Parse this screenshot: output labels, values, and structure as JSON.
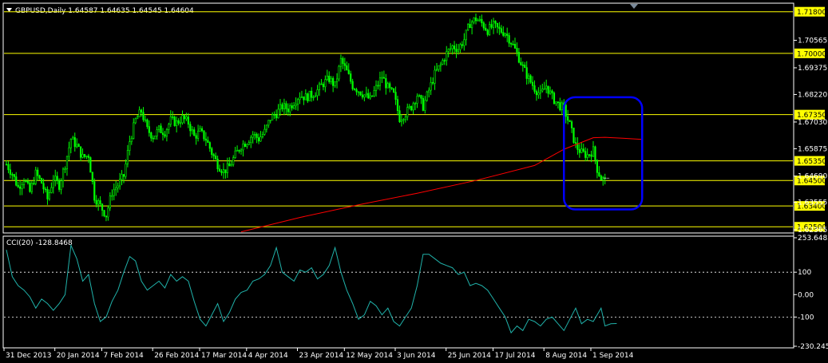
{
  "header": {
    "symbol_title": "GBPUSD,Daily  1.64587 1.64635 1.64545 1.64604"
  },
  "indicator": {
    "title": "CCI(20) -128.8468"
  },
  "colors": {
    "background": "#000000",
    "frame": "#ffffff",
    "candle": "#00ff00",
    "moving_average": "#ff0000",
    "level_line": "#ffff00",
    "level_label_bg": "#ffff00",
    "cci_line": "#20b2aa",
    "highlight_box": "#0000ff",
    "dotted_level": "#ffffff"
  },
  "chart_data": [
    {
      "type": "candlestick",
      "title": "GBPUSD,Daily  1.64587 1.64635 1.64545 1.64604",
      "x_tick_labels": [
        "31 Dec 2013",
        "20 Jan 2014",
        "7 Feb 2014",
        "26 Feb 2014",
        "17 Mar 2014",
        "4 Apr 2014",
        "23 Apr 2014",
        "12 May 2014",
        "3 Jun 2014",
        "25 Jun 2014",
        "17 Jul 2014",
        "8 Aug 2014",
        "1 Sep 2014"
      ],
      "x": [
        "2013-12-31",
        "2014-01-20",
        "2014-02-07",
        "2014-02-26",
        "2014-03-17",
        "2014-04-04",
        "2014-04-23",
        "2014-05-12",
        "2014-06-03",
        "2014-06-25",
        "2014-07-17",
        "2014-08-08",
        "2014-09-01"
      ],
      "y_tick_labels": [
        "1.70565",
        "1.69375",
        "1.68220",
        "1.67030",
        "1.65875",
        "1.64690",
        "1.63555",
        "1.62365"
      ],
      "ylim": [
        1.623,
        1.721
      ],
      "close_path": [
        [
          0,
          1.652
        ],
        [
          3,
          1.648
        ],
        [
          6,
          1.642
        ],
        [
          9,
          1.646
        ],
        [
          12,
          1.64
        ],
        [
          15,
          1.648
        ],
        [
          18,
          1.644
        ],
        [
          21,
          1.637
        ],
        [
          24,
          1.646
        ],
        [
          27,
          1.643
        ],
        [
          30,
          1.652
        ],
        [
          33,
          1.663
        ],
        [
          36,
          1.66
        ],
        [
          39,
          1.655
        ],
        [
          42,
          1.656
        ],
        [
          45,
          1.638
        ],
        [
          48,
          1.634
        ],
        [
          51,
          1.63
        ],
        [
          54,
          1.64
        ],
        [
          57,
          1.643
        ],
        [
          60,
          1.647
        ],
        [
          63,
          1.662
        ],
        [
          66,
          1.671
        ],
        [
          69,
          1.675
        ],
        [
          72,
          1.667
        ],
        [
          75,
          1.664
        ],
        [
          78,
          1.667
        ],
        [
          81,
          1.666
        ],
        [
          84,
          1.671
        ],
        [
          87,
          1.67
        ],
        [
          90,
          1.672
        ],
        [
          93,
          1.67
        ],
        [
          96,
          1.664
        ],
        [
          99,
          1.666
        ],
        [
          102,
          1.663
        ],
        [
          105,
          1.657
        ],
        [
          108,
          1.652
        ],
        [
          111,
          1.649
        ],
        [
          114,
          1.651
        ],
        [
          117,
          1.656
        ],
        [
          120,
          1.66
        ],
        [
          123,
          1.662
        ],
        [
          126,
          1.665
        ],
        [
          129,
          1.663
        ],
        [
          132,
          1.666
        ],
        [
          135,
          1.672
        ],
        [
          138,
          1.674
        ],
        [
          141,
          1.677
        ],
        [
          144,
          1.676
        ],
        [
          147,
          1.679
        ],
        [
          150,
          1.682
        ],
        [
          153,
          1.681
        ],
        [
          156,
          1.682
        ],
        [
          159,
          1.684
        ],
        [
          162,
          1.687
        ],
        [
          165,
          1.689
        ],
        [
          168,
          1.686
        ],
        [
          171,
          1.697
        ],
        [
          174,
          1.692
        ],
        [
          177,
          1.686
        ],
        [
          180,
          1.684
        ],
        [
          183,
          1.682
        ],
        [
          186,
          1.68
        ],
        [
          189,
          1.685
        ],
        [
          192,
          1.69
        ],
        [
          195,
          1.685
        ],
        [
          198,
          1.682
        ],
        [
          201,
          1.672
        ],
        [
          204,
          1.674
        ],
        [
          207,
          1.677
        ],
        [
          210,
          1.682
        ],
        [
          213,
          1.677
        ],
        [
          216,
          1.684
        ],
        [
          219,
          1.691
        ],
        [
          222,
          1.695
        ],
        [
          225,
          1.7
        ],
        [
          228,
          1.703
        ],
        [
          231,
          1.702
        ],
        [
          234,
          1.706
        ],
        [
          237,
          1.713
        ],
        [
          240,
          1.715
        ],
        [
          243,
          1.713
        ],
        [
          246,
          1.71
        ],
        [
          249,
          1.712
        ],
        [
          252,
          1.71
        ],
        [
          255,
          1.709
        ],
        [
          258,
          1.705
        ],
        [
          261,
          1.7
        ],
        [
          264,
          1.694
        ],
        [
          267,
          1.689
        ],
        [
          270,
          1.685
        ],
        [
          273,
          1.682
        ],
        [
          276,
          1.686
        ],
        [
          279,
          1.681
        ],
        [
          282,
          1.678
        ],
        [
          285,
          1.676
        ],
        [
          288,
          1.669
        ],
        [
          291,
          1.66
        ],
        [
          294,
          1.657
        ],
        [
          297,
          1.656
        ],
        [
          300,
          1.658
        ],
        [
          302,
          1.65
        ],
        [
          304,
          1.646
        ],
        [
          306,
          1.645
        ]
      ],
      "moving_average_path": [
        [
          120,
          1.6228
        ],
        [
          150,
          1.629
        ],
        [
          180,
          1.6345
        ],
        [
          210,
          1.6395
        ],
        [
          240,
          1.645
        ],
        [
          270,
          1.6515
        ],
        [
          285,
          1.6585
        ],
        [
          300,
          1.6635
        ],
        [
          306,
          1.6637
        ],
        [
          315,
          1.6633
        ],
        [
          325,
          1.6628
        ]
      ],
      "horizontal_levels": [
        "1.71800",
        "1.70000",
        "1.67350",
        "1.65350",
        "1.64500",
        "1.63400",
        "1.62500"
      ],
      "horizontal_level_values": [
        1.718,
        1.7,
        1.6735,
        1.6535,
        1.645,
        1.634,
        1.625
      ],
      "highlight_range": {
        "x": [
          285,
          325
        ],
        "y": [
          1.6325,
          1.681
        ]
      }
    },
    {
      "type": "line",
      "title": "CCI(20) -128.8468",
      "y_tick_labels": [
        "253.6482",
        "100",
        "0.00",
        "-100",
        "-230.2458"
      ],
      "ylim": [
        -230.2458,
        253.6482
      ],
      "dotted_levels": [
        100,
        -100
      ],
      "series": [
        {
          "x": [
            0,
            3,
            6,
            9,
            12,
            15,
            18,
            21,
            24,
            27,
            30,
            33,
            36,
            39,
            42,
            45,
            48,
            51,
            54,
            57,
            60,
            63,
            66,
            69,
            72,
            75,
            78,
            81,
            84,
            87,
            90,
            93,
            96,
            99,
            102,
            105,
            108,
            111,
            114,
            117,
            120,
            123,
            126,
            129,
            132,
            135,
            138,
            141,
            144,
            147,
            150,
            153,
            156,
            159,
            162,
            165,
            168,
            171,
            174,
            177,
            180,
            183,
            186,
            189,
            192,
            195,
            198,
            201,
            204,
            207,
            210,
            213,
            216,
            219,
            222,
            225,
            228,
            231,
            234,
            237,
            240,
            243,
            246,
            249,
            252,
            255,
            258,
            261,
            264,
            267,
            270,
            273,
            276,
            279,
            282,
            285,
            288,
            291,
            294,
            297,
            300,
            302,
            304,
            306,
            309,
            312
          ],
          "values": [
            200,
            80,
            40,
            20,
            -10,
            -60,
            -20,
            -40,
            -70,
            -40,
            0,
            220,
            160,
            60,
            90,
            -40,
            -120,
            -100,
            -30,
            20,
            100,
            170,
            150,
            60,
            20,
            40,
            60,
            30,
            90,
            60,
            80,
            60,
            -30,
            -110,
            -140,
            -90,
            -40,
            -120,
            -80,
            -20,
            10,
            20,
            60,
            70,
            90,
            130,
            210,
            100,
            80,
            60,
            110,
            100,
            120,
            70,
            90,
            130,
            210,
            100,
            20,
            -40,
            -110,
            -90,
            -30,
            -50,
            -90,
            -60,
            -120,
            -140,
            -100,
            -60,
            40,
            180,
            180,
            160,
            140,
            130,
            120,
            90,
            100,
            40,
            50,
            40,
            20,
            -20,
            -60,
            -100,
            -170,
            -140,
            -160,
            -110,
            -120,
            -140,
            -110,
            -100,
            -130,
            -160,
            -110,
            -60,
            -130,
            -110,
            -120,
            -90,
            -60,
            -140,
            -130,
            -128.85
          ]
        }
      ]
    }
  ]
}
